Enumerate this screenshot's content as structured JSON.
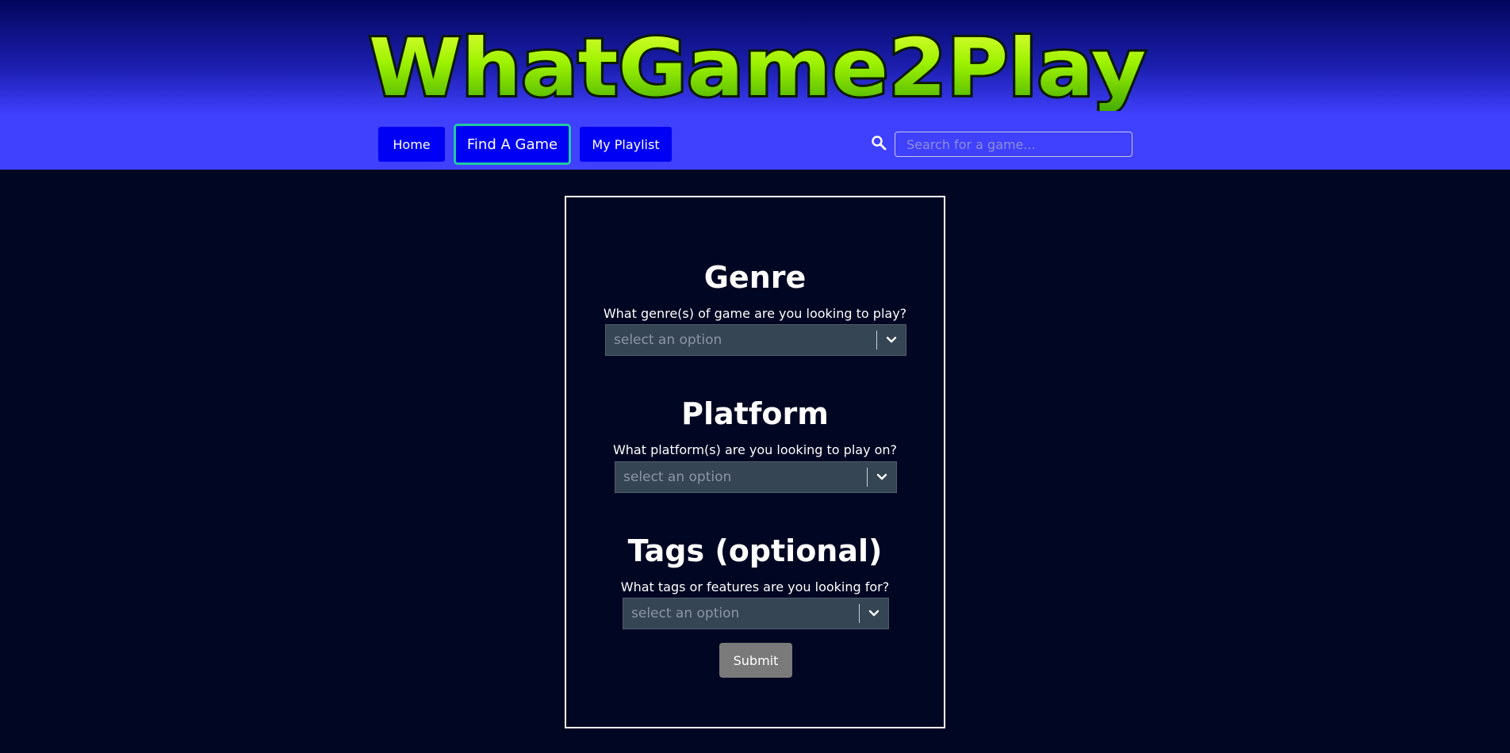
{
  "brand": {
    "logo_text": "WhatGame2Play"
  },
  "nav": {
    "home_label": "Home",
    "find_label": "Find A Game",
    "playlist_label": "My Playlist"
  },
  "search": {
    "placeholder": "Search for a game...",
    "icon": "search-icon"
  },
  "form": {
    "genre": {
      "title": "Genre",
      "question": "What genre(s) of game are you looking to play?",
      "placeholder": "select an option"
    },
    "platform": {
      "title": "Platform",
      "question": "What platform(s) are you looking to play on?",
      "placeholder": "select an option"
    },
    "tags": {
      "title": "Tags (optional)",
      "question": "What tags or features are you looking for?",
      "placeholder": "select an option"
    },
    "submit_label": "Submit"
  },
  "colors": {
    "page_bg": "#010622",
    "header_blue": "#4040ff",
    "nav_button": "#0000f5",
    "active_outline": "#22c9a2",
    "logo_green": "#7be300",
    "select_bg": "#364554",
    "submit_bg": "#7a7a7a"
  }
}
